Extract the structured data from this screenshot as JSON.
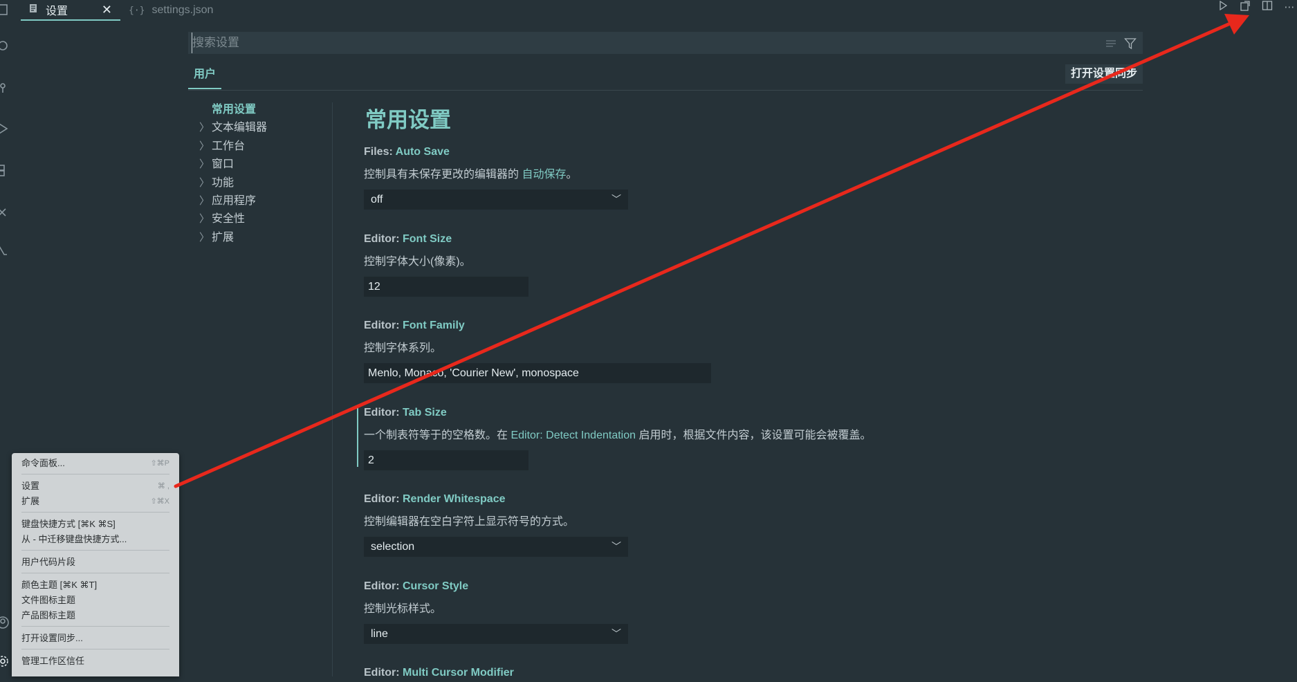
{
  "tabs": [
    {
      "label": "设置",
      "active": true,
      "closable": true
    },
    {
      "label": "settings.json",
      "active": false
    }
  ],
  "editor_actions": [
    "run-icon",
    "open-settings-json-icon",
    "split-editor-icon",
    "more-actions-icon"
  ],
  "search": {
    "placeholder": "搜索设置",
    "value": ""
  },
  "scope_tab": "用户",
  "sync_button": "打开设置同步",
  "toc": [
    {
      "label": "常用设置",
      "selected": true,
      "expandable": false
    },
    {
      "label": "文本编辑器",
      "expandable": true
    },
    {
      "label": "工作台",
      "expandable": true
    },
    {
      "label": "窗口",
      "expandable": true
    },
    {
      "label": "功能",
      "expandable": true
    },
    {
      "label": "应用程序",
      "expandable": true
    },
    {
      "label": "安全性",
      "expandable": true
    },
    {
      "label": "扩展",
      "expandable": true
    }
  ],
  "page_title": "常用设置",
  "settings": [
    {
      "category": "Files: ",
      "key": "Auto Save",
      "desc_before": "控制具有未保存更改的编辑器的 ",
      "desc_link": "自动保存",
      "desc_after": "。",
      "control": "select",
      "value": "off"
    },
    {
      "category": "Editor: ",
      "key": "Font Size",
      "desc": "控制字体大小(像素)。",
      "control": "text",
      "value": "12"
    },
    {
      "category": "Editor: ",
      "key": "Font Family",
      "desc": "控制字体系列。",
      "control": "text",
      "value": "Menlo, Monaco, 'Courier New', monospace"
    },
    {
      "category": "Editor: ",
      "key": "Tab Size",
      "desc_before": "一个制表符等于的空格数。在 ",
      "desc_link": "Editor: Detect Indentation",
      "desc_after": " 启用时，根据文件内容，该设置可能会被覆盖。",
      "control": "text",
      "value": "2",
      "modified": true
    },
    {
      "category": "Editor: ",
      "key": "Render Whitespace",
      "desc": "控制编辑器在空白字符上显示符号的方式。",
      "control": "select",
      "value": "selection"
    },
    {
      "category": "Editor: ",
      "key": "Cursor Style",
      "desc": "控制光标样式。",
      "control": "select",
      "value": "line"
    },
    {
      "category": "Editor: ",
      "key": "Multi Cursor Modifier"
    }
  ],
  "menu": [
    {
      "label": "命令面板...",
      "shortcut": "⇧⌘P"
    },
    {
      "label": "设置",
      "shortcut": "⌘ ,"
    },
    {
      "label": "扩展",
      "shortcut": "⇧⌘X"
    },
    {
      "label": "键盘快捷方式 [⌘K ⌘S]",
      "shortcut": ""
    },
    {
      "label": "从 - 中迁移键盘快捷方式...",
      "shortcut": ""
    },
    {
      "label": "用户代码片段",
      "shortcut": ""
    },
    {
      "label": "颜色主题 [⌘K ⌘T]",
      "shortcut": ""
    },
    {
      "label": "文件图标主题",
      "shortcut": ""
    },
    {
      "label": "产品图标主题",
      "shortcut": ""
    },
    {
      "label": "打开设置同步...",
      "shortcut": ""
    },
    {
      "label": "管理工作区信任",
      "shortcut": ""
    }
  ],
  "colors": {
    "accent": "#80cbc4",
    "background": "#263238",
    "annotation": "#e8281c",
    "menu_bg": "#cfd3d5"
  }
}
